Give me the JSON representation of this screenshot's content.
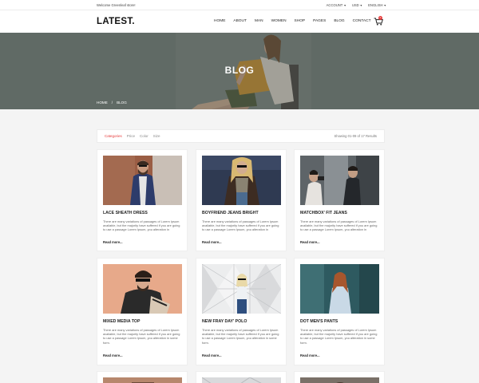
{
  "topbar": {
    "welcome": "Welcome Greenleaf store!",
    "account": "ACCOUNT",
    "currency": "USD",
    "language": "ENGLISH"
  },
  "header": {
    "logo": "LATEST.",
    "nav": [
      "HOME",
      "ABOUT",
      "MAN",
      "WOMEN",
      "SHOP",
      "PAGES",
      "BLOG",
      "CONTACT"
    ],
    "cart_count": "0"
  },
  "hero": {
    "title": "BLOG",
    "breadcrumb": [
      "HOME",
      "/",
      "BLOG"
    ]
  },
  "filter": {
    "tabs": [
      "Categories",
      "Price",
      "Color",
      "Size"
    ],
    "results": "Showing 01-09 of 17 Results"
  },
  "posts": [
    {
      "title": "LACE SHEATH DRESS",
      "desc": "There are many variations of passages of Lorem Ipsum available, but the majority have suffered if you are going to use a passage Lorem Ipsum, you alteration in",
      "more": "Read more..."
    },
    {
      "title": "BOYFRIEND JEANS BRIGHT",
      "desc": "There are many variations of passages of Lorem Ipsum available, but the majority have suffered if you are going to use a passage Lorem Ipsum, you alteration in",
      "more": "Read more..."
    },
    {
      "title": "MATCHBOX' FIT JEANS",
      "desc": "There are many variations of passages of Lorem Ipsum available, but the majority have suffered if you are going to use a passage Lorem Ipsum, you alteration in",
      "more": "Read more..."
    },
    {
      "title": "MIXED MEDIA TOP",
      "desc": "There are many variations of passages of Lorem Ipsum available, but the majority have suffered if you are going to use a passage Lorem Ipsum, you alteration in some form.",
      "more": "Read more..."
    },
    {
      "title": "NEW FRAY DAY' POLO",
      "desc": "There are many variations of passages of Lorem Ipsum available, but the majority have suffered if you are going to use a passage Lorem Ipsum, you alteration in some form.",
      "more": "Read more..."
    },
    {
      "title": "DOT MEN'S PANTS",
      "desc": "There are many variations of passages of Lorem Ipsum available, but the majority have suffered if you are going to use a passage Lorem Ipsum, you alteration in some form.",
      "more": "Read more..."
    }
  ],
  "colors": {
    "accent": "#e63a3a",
    "text": "#222222",
    "background": "#f4f4f4"
  }
}
